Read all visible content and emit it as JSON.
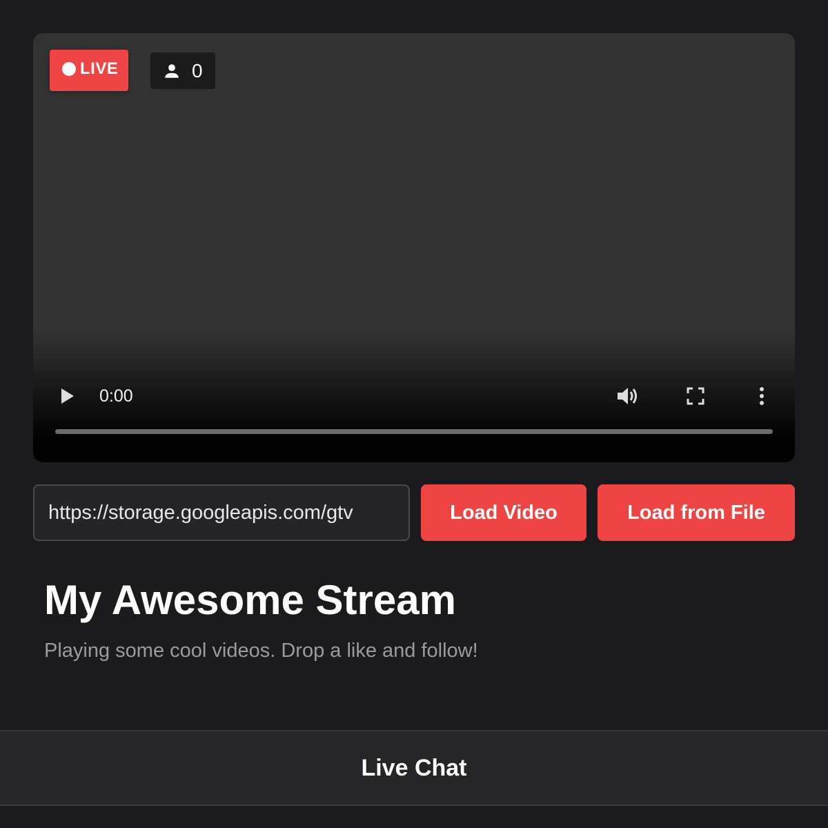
{
  "player": {
    "live_label": "LIVE",
    "viewer_count": "0",
    "current_time": "0:00",
    "progress": 0,
    "icons": {
      "viewer": "user-icon",
      "play": "play-icon",
      "volume": "volume-icon",
      "fullscreen": "fullscreen-icon",
      "more": "more-vertical-icon"
    }
  },
  "loader": {
    "url_value": "https://storage.googleapis.com/gtv",
    "load_video_label": "Load Video",
    "load_file_label": "Load from File"
  },
  "stream": {
    "title": "My Awesome Stream",
    "description": "Playing some cool videos. Drop a like and follow!"
  },
  "chat": {
    "header": "Live Chat"
  },
  "colors": {
    "accent": "#ef4444",
    "background": "#1b1b1d",
    "player_bg": "#333333"
  }
}
